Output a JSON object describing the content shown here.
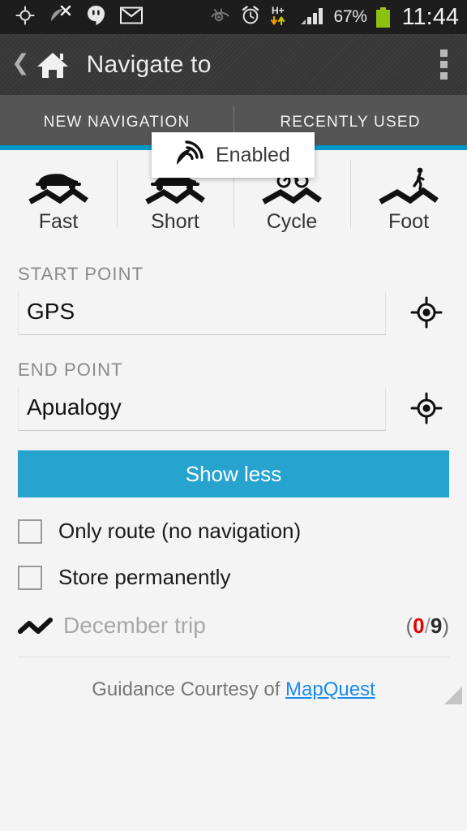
{
  "statusbar": {
    "icons_left": [
      "gps-crosshair-icon",
      "satellite-off-icon",
      "hangouts-icon",
      "gmail-icon"
    ],
    "icons_right": [
      "eye-off-icon",
      "alarm-icon",
      "hplus-data-icon",
      "signal-bars-icon"
    ],
    "battery_percent": "67%",
    "clock": "11:44"
  },
  "actionbar": {
    "back_icon": "back-chevron-icon",
    "home_icon": "home-icon",
    "title": "Navigate to",
    "overflow_icon": "overflow-menu-icon"
  },
  "tabs": {
    "items": [
      {
        "label": "NEW NAVIGATION",
        "selected": true
      },
      {
        "label": "RECENTLY USED",
        "selected": false
      }
    ],
    "indicator_color": "#0099cc"
  },
  "toast": {
    "icon": "gps-satellite-icon",
    "label": "Enabled"
  },
  "modes": {
    "items": [
      {
        "label": "Fast",
        "icon": "convertible-car-route-icon"
      },
      {
        "label": "Short",
        "icon": "car-route-icon"
      },
      {
        "label": "Cycle",
        "icon": "bicycle-route-icon"
      },
      {
        "label": "Foot",
        "icon": "walking-route-icon"
      }
    ]
  },
  "start_point": {
    "label": "START POINT",
    "value": "GPS",
    "placeholder": "Start point",
    "locate_icon": "my-location-icon"
  },
  "end_point": {
    "label": "END POINT",
    "value": "Apualogy",
    "placeholder": "End point",
    "locate_icon": "my-location-icon"
  },
  "primary_button": {
    "label": "Show less"
  },
  "options": [
    {
      "label": "Only route (no navigation)",
      "checked": false
    },
    {
      "label": "Store permanently",
      "checked": false
    }
  ],
  "trip": {
    "icon": "route-zigzag-icon",
    "name": "December trip",
    "paren_open": "(",
    "count_done": "0",
    "separator": "/",
    "count_total": "9",
    "paren_close": ")",
    "done_color": "#e50000"
  },
  "footer": {
    "text": "Guidance Courtesy of",
    "link": "MapQuest"
  }
}
